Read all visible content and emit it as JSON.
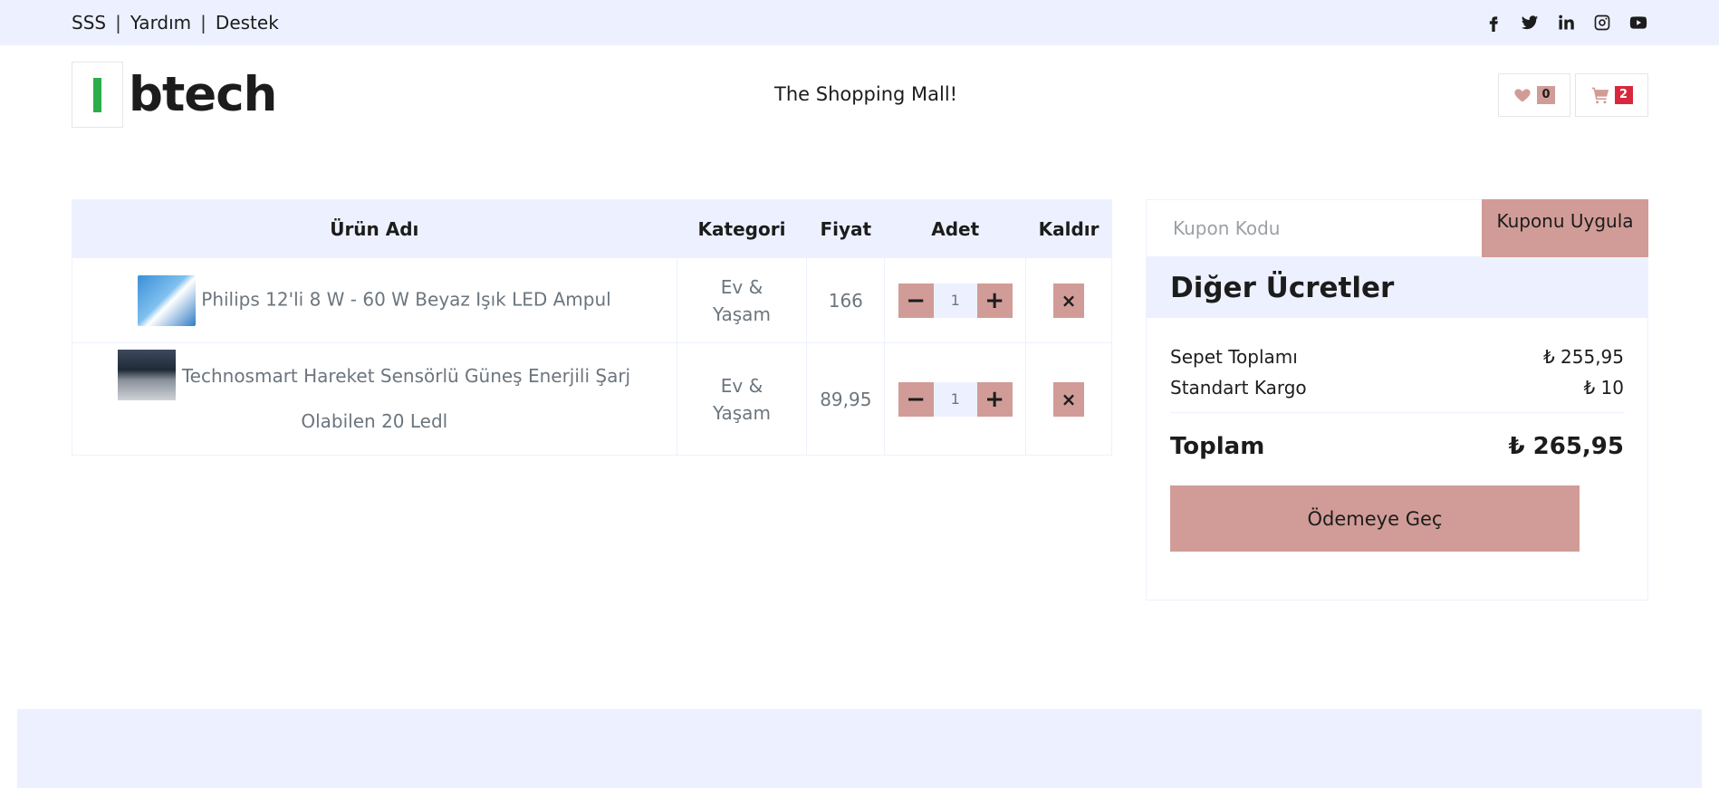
{
  "topbar": {
    "links": [
      "SSS",
      "Yardım",
      "Destek"
    ],
    "separator": "|",
    "social_icons": [
      "facebook-icon",
      "twitter-icon",
      "linkedin-icon",
      "instagram-icon",
      "youtube-icon"
    ]
  },
  "header": {
    "logo_text": "btech",
    "tagline": "The Shopping Mall!",
    "wishlist_count": "0",
    "cart_count": "2"
  },
  "cart": {
    "columns": [
      "Ürün Adı",
      "Kategori",
      "Fiyat",
      "Adet",
      "Kaldır"
    ],
    "rows": [
      {
        "name": "Philips 12'li 8 W - 60 W Beyaz Işık LED Ampul",
        "category": "Ev & Yaşam",
        "price": "166",
        "qty": "1",
        "remove": "×"
      },
      {
        "name": "Technosmart Hareket Sensörlü Güneş Enerjili Şarj Olabilen 20 Ledl",
        "category": "Ev & Yaşam",
        "price": "89,95",
        "qty": "1",
        "remove": "×"
      }
    ],
    "minus": "−",
    "plus": "+"
  },
  "coupon": {
    "placeholder": "Kupon Kodu",
    "button": "Kuponu Uygula"
  },
  "summary": {
    "title": "Diğer Ücretler",
    "subtotal_label": "Sepet Toplamı",
    "subtotal_value": "₺ 255,95",
    "shipping_label": "Standart Kargo",
    "shipping_value": "₺ 10",
    "total_label": "Toplam",
    "total_value": "₺ 265,95",
    "checkout_button": "Ödemeye Geç"
  },
  "colors": {
    "accent": "#d19c97",
    "light_bg": "#edf1ff",
    "logo_green": "#2bad4a",
    "cart_badge": "#d9283d"
  }
}
